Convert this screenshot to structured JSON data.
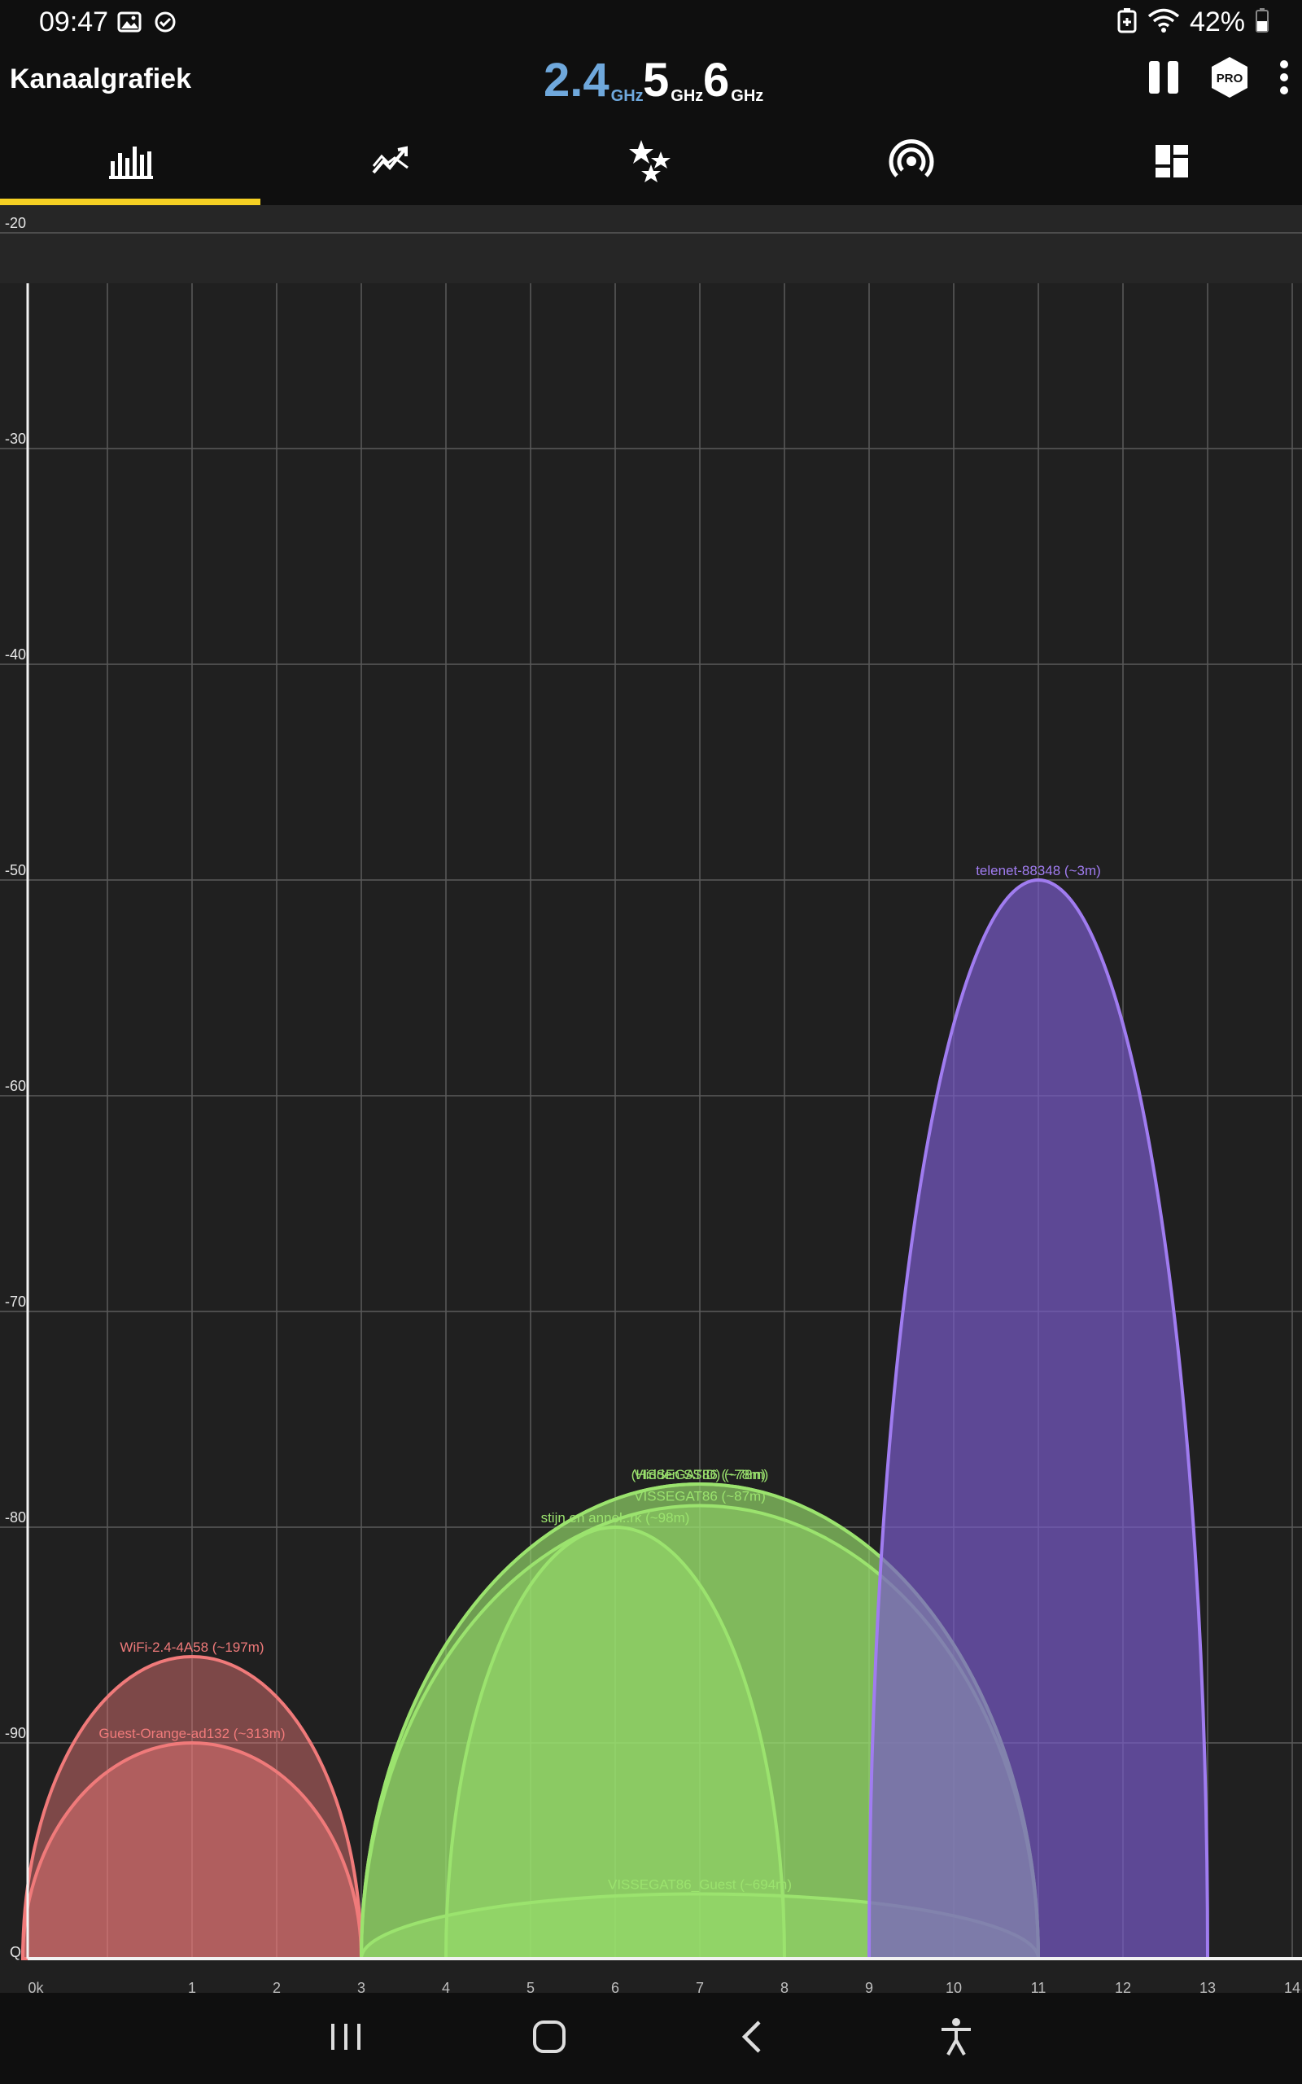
{
  "status_bar": {
    "time": "09:47",
    "battery_percent": "42%",
    "icons_left": [
      "image-icon",
      "check-circle-icon"
    ],
    "icons_right": [
      "battery-saver-icon",
      "wifi-icon",
      "battery-icon"
    ]
  },
  "app_bar": {
    "title": "Kanaalgrafiek",
    "bands": [
      {
        "value": "2.4",
        "unit": "GHz",
        "active": true
      },
      {
        "value": "5",
        "unit": "GHz",
        "active": false
      },
      {
        "value": "6",
        "unit": "GHz",
        "active": false
      }
    ],
    "actions": [
      "pause-icon",
      "pro-badge-icon",
      "more-vert-icon"
    ],
    "pro_label": "PRO"
  },
  "tabs": [
    {
      "name": "channel-graph",
      "icon": "bar-chart-icon",
      "active": true
    },
    {
      "name": "time-graph",
      "icon": "line-chart-icon",
      "active": false
    },
    {
      "name": "channel-rating",
      "icon": "stars-icon",
      "active": false
    },
    {
      "name": "access-points",
      "icon": "wifi-signal-icon",
      "active": false
    },
    {
      "name": "dashboard",
      "icon": "dashboard-icon",
      "active": false
    }
  ],
  "colors": {
    "accent": "#f5d023",
    "band_active": "#6fa8dc",
    "red": "#f07a7a",
    "green": "#9be36e",
    "purple": "#a07cf0",
    "grid": "#5a5a5a",
    "background": "#202020"
  },
  "chart_data": {
    "type": "area",
    "title": "",
    "xlabel": "",
    "ylabel": "",
    "y_ticks": [
      "-20",
      "-30",
      "-40",
      "-50",
      "-60",
      "-70",
      "-80",
      "-90"
    ],
    "y_range": [
      -100,
      -20
    ],
    "x_tick_labels": [
      "0k",
      "1",
      "2",
      "3",
      "4",
      "5",
      "6",
      "7",
      "8",
      "9",
      "10",
      "11",
      "12",
      "13",
      "14"
    ],
    "x_range": [
      -2,
      14
    ],
    "floor_label": "Q",
    "networks": [
      {
        "label": "WiFi-2.4-4A58 (~197m)",
        "channel": 1,
        "width": 20,
        "signal": -86,
        "color": "red"
      },
      {
        "label": "Guest-Orange-ad132 (~313m)",
        "channel": 1,
        "width": 20,
        "signal": -90,
        "color": "red"
      },
      {
        "label": "VISSEGAT86 (~78m)",
        "channel": 7,
        "width": 40,
        "signal": -78,
        "color": "green"
      },
      {
        "label": "(Hidden SSID) (~78m)",
        "channel": 7,
        "width": 40,
        "signal": -78,
        "color": "green"
      },
      {
        "label": "VISSEGAT86 (~87m)",
        "channel": 7,
        "width": 40,
        "signal": -79,
        "color": "green"
      },
      {
        "label": "stijn en annel..rk (~98m)",
        "channel": 6,
        "width": 20,
        "signal": -80,
        "color": "green"
      },
      {
        "label": "VISSEGAT86_Guest (~694m)",
        "channel": 7,
        "width": 40,
        "signal": -97,
        "color": "green"
      },
      {
        "label": "telenet-88348 (~3m)",
        "channel": 11,
        "width": 20,
        "signal": -50,
        "color": "purple"
      }
    ]
  },
  "nav_bar": {
    "buttons": [
      "recent-apps-icon",
      "home-icon",
      "back-icon",
      "accessibility-icon"
    ]
  }
}
